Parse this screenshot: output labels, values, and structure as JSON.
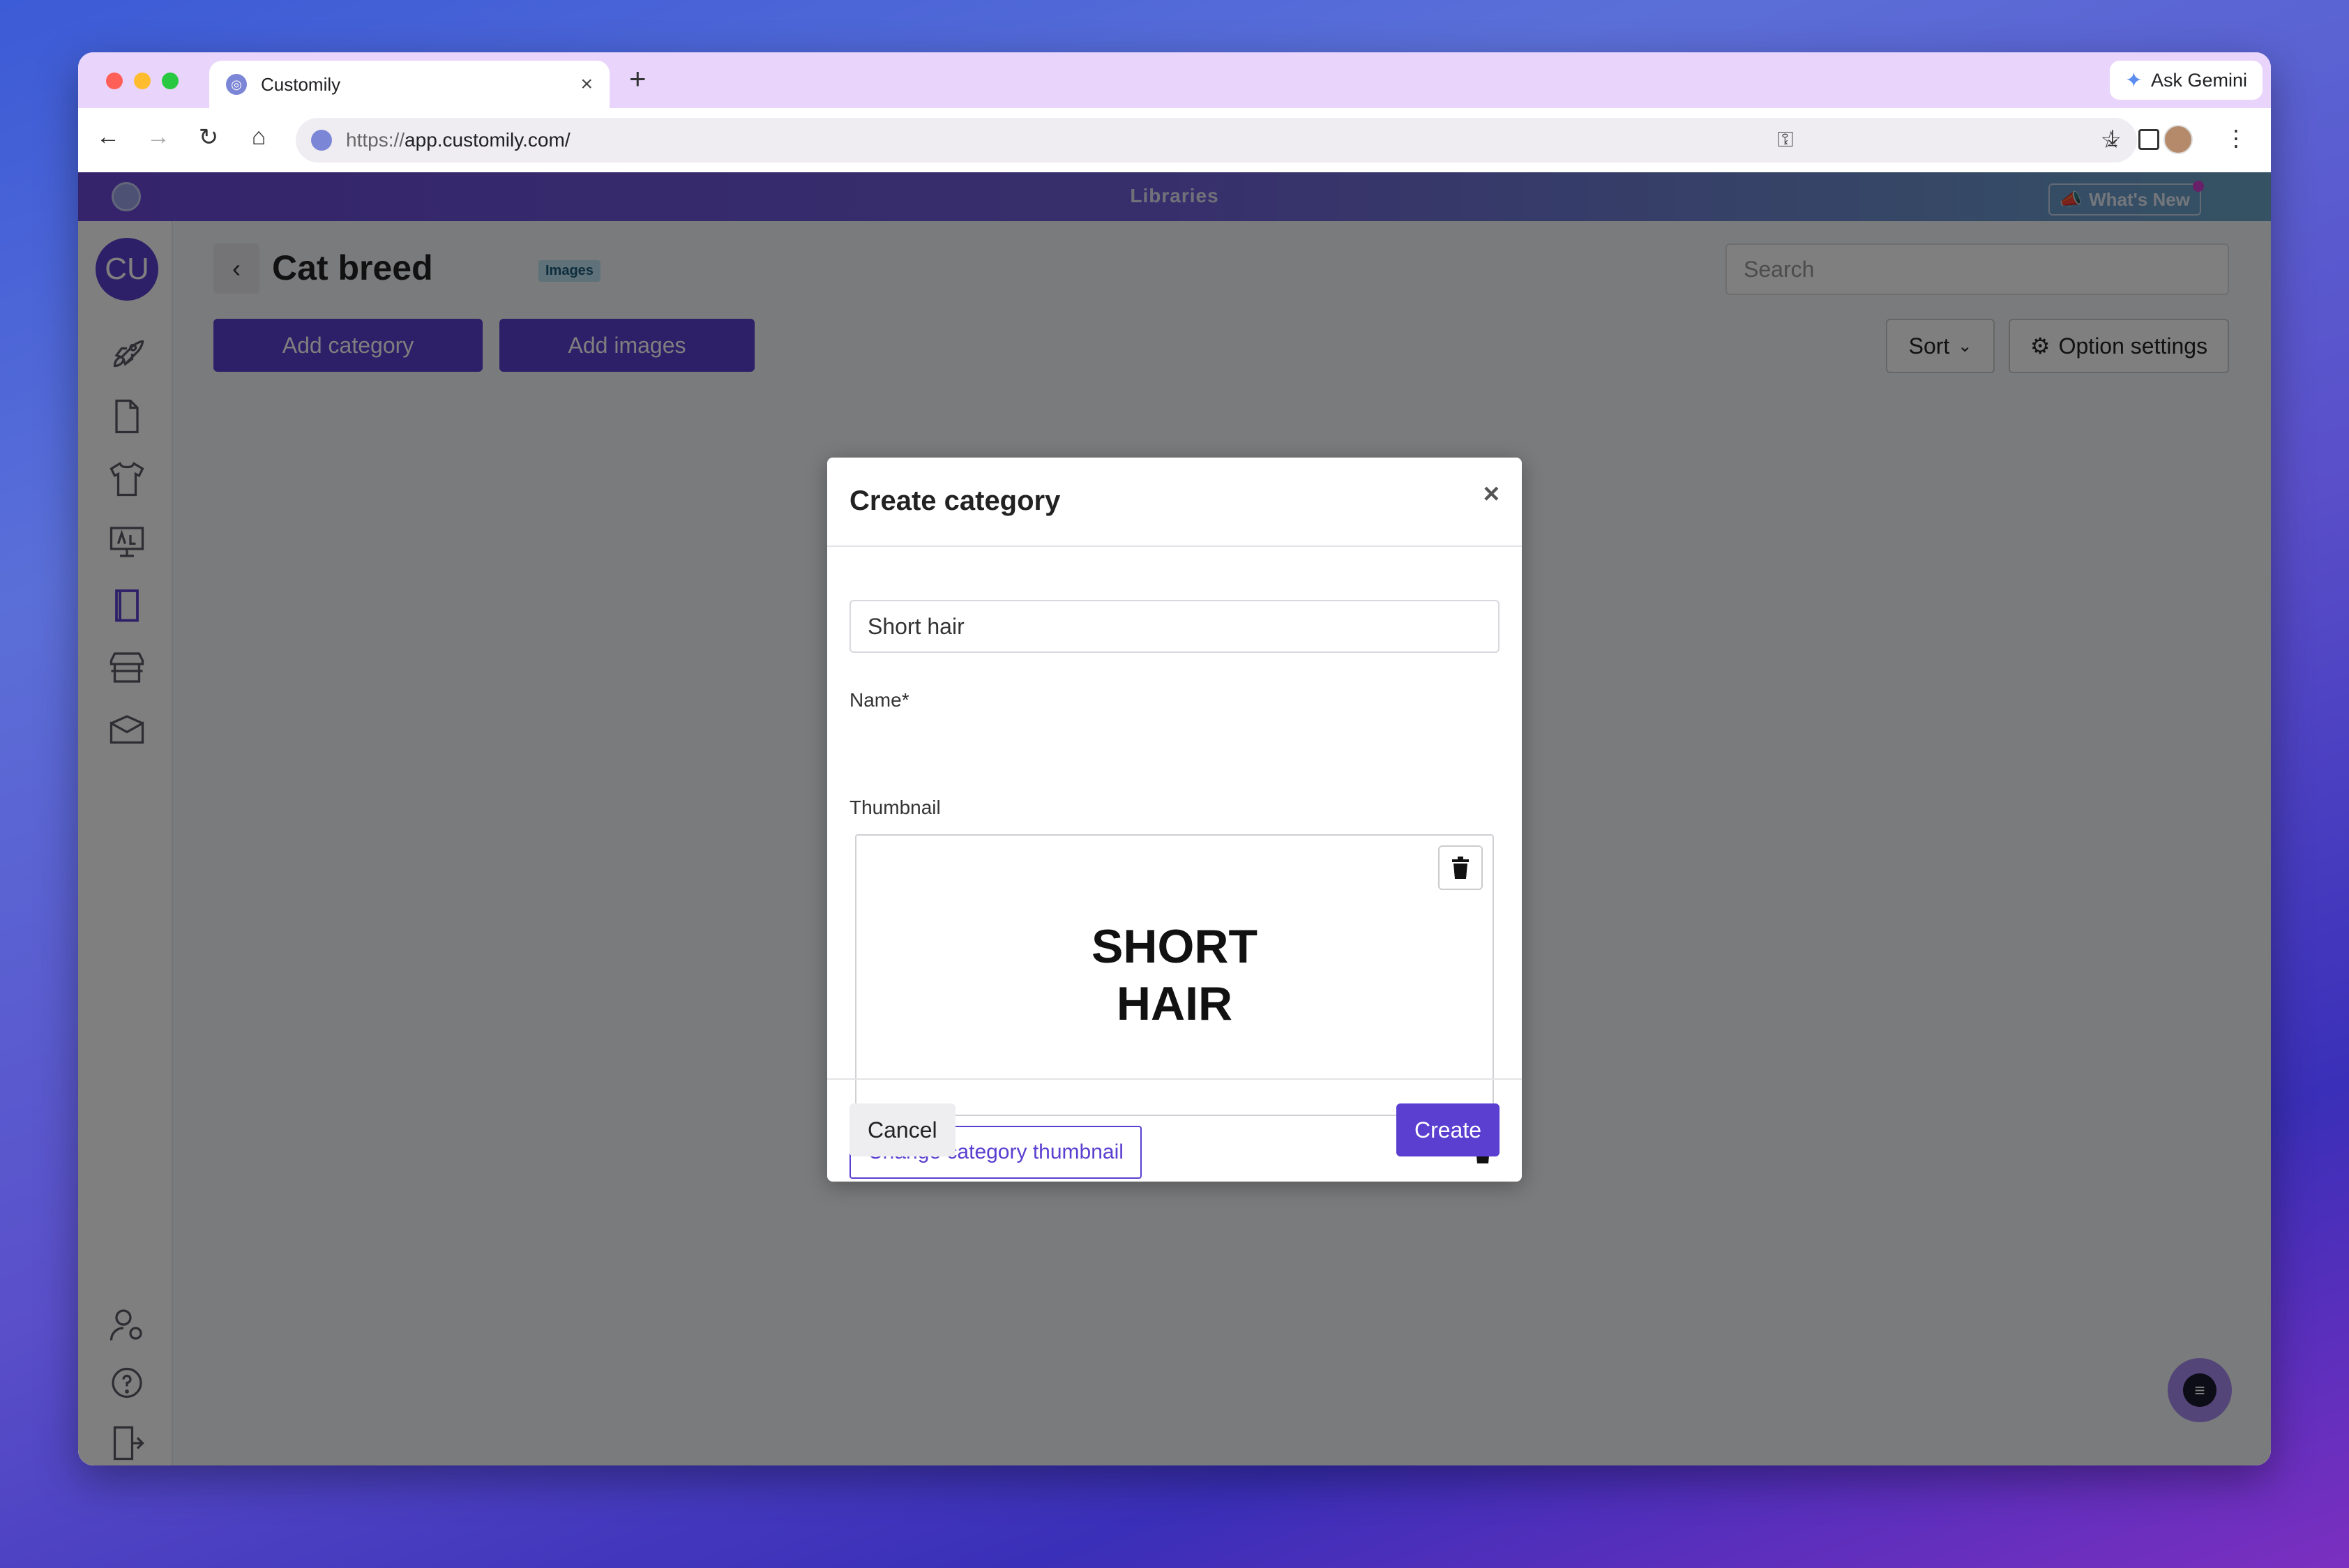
{
  "browser": {
    "tab_title": "Customily",
    "new_tab": "+",
    "close_tab": "×",
    "gemini_label": "Ask Gemini",
    "url_scheme": "https://",
    "url_host": "app.customily.com/"
  },
  "app": {
    "header_title": "Libraries",
    "whats_new": "What's New",
    "user_initials": "CU"
  },
  "page": {
    "title": "Cat breed",
    "badge": "Images",
    "search_placeholder": "Search",
    "add_category": "Add category",
    "add_images": "Add images",
    "sort": "Sort",
    "option_settings": "Option settings"
  },
  "modal": {
    "title": "Create category",
    "close": "×",
    "name_label": "Name*",
    "name_value": "Short hair",
    "thumbnail_label": "Thumbnail",
    "thumbnail_line1": "SHORT",
    "thumbnail_line2": "HAIR",
    "change_thumbnail": "Change category thumbnail",
    "cancel": "Cancel",
    "create": "Create"
  },
  "colors": {
    "primary": "#5a3fd0",
    "tabstrip": "#e9d5fb"
  }
}
